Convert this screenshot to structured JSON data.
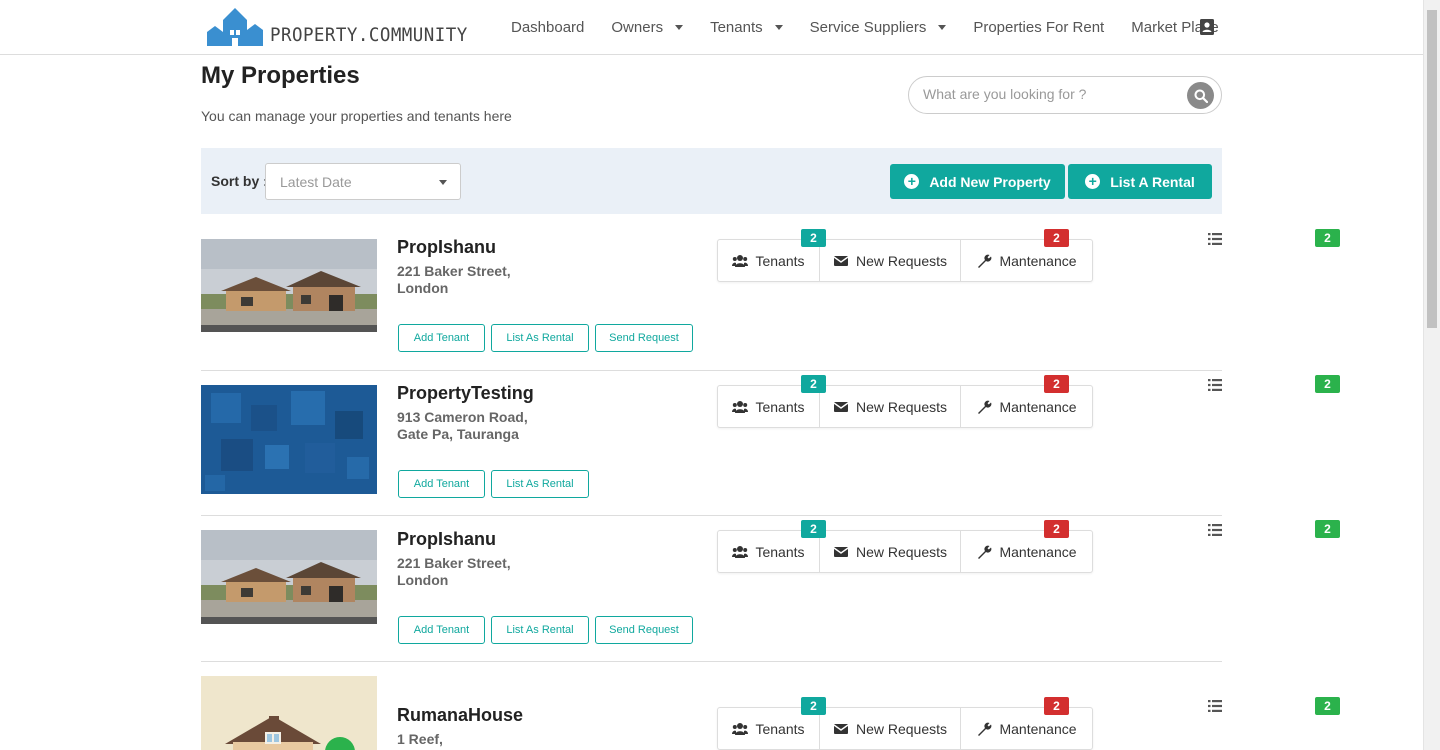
{
  "app": {
    "logo_text": "PROPERTY.COMMUNITY",
    "nav": [
      {
        "label": "Dashboard",
        "dropdown": false
      },
      {
        "label": "Owners",
        "dropdown": true
      },
      {
        "label": "Tenants",
        "dropdown": true
      },
      {
        "label": "Service Suppliers",
        "dropdown": true
      },
      {
        "label": "Properties For Rent",
        "dropdown": false
      },
      {
        "label": "Market Place",
        "dropdown": false
      }
    ],
    "profile_icon": "contact-card-icon"
  },
  "page": {
    "title": "My Properties",
    "subtitle": "You can manage your properties and tenants here",
    "search_placeholder": "What are you looking for ?"
  },
  "toolbar": {
    "sort_label": "Sort by :",
    "sort_value": "Latest Date",
    "add_property_label": "Add New Property",
    "list_rental_label": "List A Rental"
  },
  "stat_labels": {
    "tenants": "Tenants",
    "requests": "New Requests",
    "maintenance": "Mantenance"
  },
  "colors": {
    "accent": "#10a89e",
    "badge_teal": "#10a89e",
    "badge_red": "#d32f2f",
    "badge_green": "#2bb24c"
  },
  "properties": [
    {
      "name": "PropIshanu",
      "address_line1": "221 Baker Street,",
      "address_line2": "London",
      "image": "house-photo",
      "actions": [
        "Add Tenant",
        "List As Rental",
        "Send Request"
      ],
      "tenants_count": "2",
      "requests_count": "2",
      "maintenance_count": "2"
    },
    {
      "name": "PropertyTesting",
      "address_line1": "913 Cameron Road,",
      "address_line2": "Gate Pa, Tauranga",
      "image": "blue-pattern",
      "actions": [
        "Add Tenant",
        "List As Rental"
      ],
      "tenants_count": "2",
      "requests_count": "2",
      "maintenance_count": "2"
    },
    {
      "name": "PropIshanu",
      "address_line1": "221 Baker Street,",
      "address_line2": "London",
      "image": "house-photo",
      "actions": [
        "Add Tenant",
        "List As Rental",
        "Send Request"
      ],
      "tenants_count": "2",
      "requests_count": "2",
      "maintenance_count": "2"
    },
    {
      "name": "RumanaHouse",
      "address_line1": "1 Reef,",
      "address_line2": "",
      "image": "house-illustration",
      "actions": [],
      "tenants_count": "2",
      "requests_count": "2",
      "maintenance_count": "2"
    }
  ]
}
